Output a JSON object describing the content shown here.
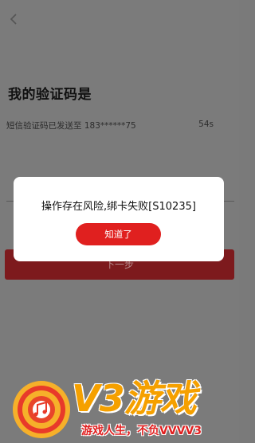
{
  "screen": {
    "heading": "我的验证码是",
    "sms_info": "短信验证码已发送至 183******75",
    "countdown": "54s",
    "next_button": "下一步"
  },
  "dialog": {
    "message": "操作存在风险,绑卡失败[S10235]",
    "ok_button": "知道了"
  },
  "watermark": {
    "logo_text": "V3",
    "title": "游戏",
    "subtitle": "游戏人生，不负VVVV3"
  },
  "colors": {
    "accent": "#e0201f",
    "overlay": "#7b7b7b",
    "watermark_orange": "#f5a000"
  }
}
